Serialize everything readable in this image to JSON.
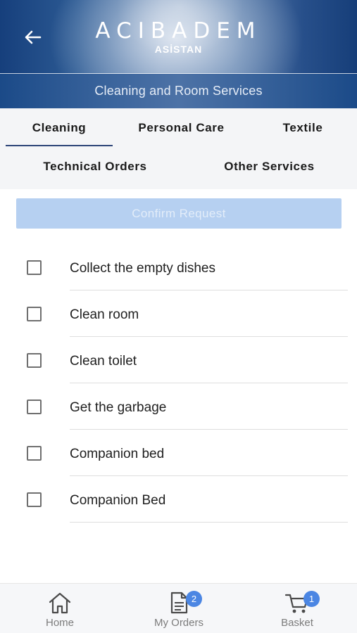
{
  "header": {
    "brand": "ACIBADEM",
    "brand_sub": "ASİSTAN",
    "title": "Cleaning and Room Services",
    "back_icon": "arrow-left-icon"
  },
  "tabs": [
    {
      "label": "Cleaning",
      "active": true
    },
    {
      "label": "Personal Care",
      "active": false
    },
    {
      "label": "Textile",
      "active": false
    },
    {
      "label": "Technical Orders",
      "active": false
    },
    {
      "label": "Other Services",
      "active": false
    }
  ],
  "confirm_label": "Confirm Request",
  "items": [
    {
      "label": "Collect the empty dishes",
      "checked": false
    },
    {
      "label": "Clean room",
      "checked": false
    },
    {
      "label": "Clean toilet",
      "checked": false
    },
    {
      "label": "Get the garbage",
      "checked": false
    },
    {
      "label": "Companion bed",
      "checked": false
    },
    {
      "label": "Companion Bed",
      "checked": false
    }
  ],
  "nav": {
    "home": {
      "label": "Home",
      "icon": "home-icon"
    },
    "orders": {
      "label": "My Orders",
      "icon": "document-icon",
      "badge": "2"
    },
    "basket": {
      "label": "Basket",
      "icon": "cart-icon",
      "badge": "1"
    }
  },
  "colors": {
    "primary": "#2d4478",
    "confirm_disabled": "#b6d0f1",
    "badge": "#4b86e3"
  }
}
